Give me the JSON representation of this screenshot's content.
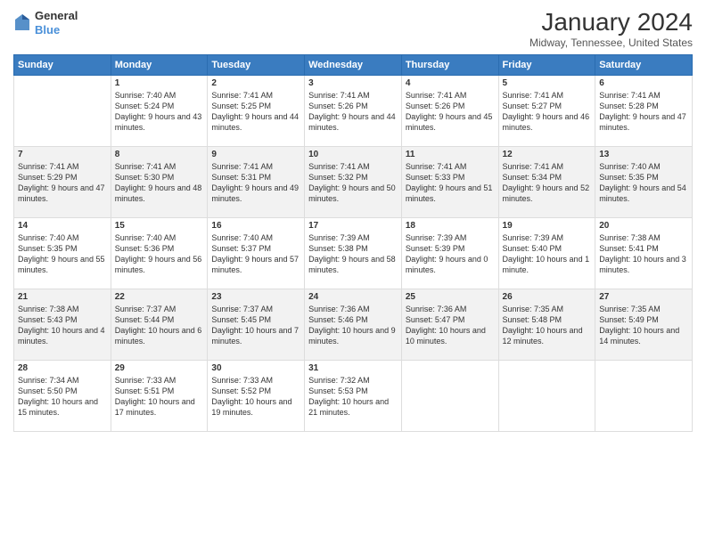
{
  "header": {
    "logo_general": "General",
    "logo_blue": "Blue",
    "title": "January 2024",
    "location": "Midway, Tennessee, United States"
  },
  "weekdays": [
    "Sunday",
    "Monday",
    "Tuesday",
    "Wednesday",
    "Thursday",
    "Friday",
    "Saturday"
  ],
  "weeks": [
    [
      {
        "day": "",
        "sunrise": "",
        "sunset": "",
        "daylight": ""
      },
      {
        "day": "1",
        "sunrise": "Sunrise: 7:40 AM",
        "sunset": "Sunset: 5:24 PM",
        "daylight": "Daylight: 9 hours and 43 minutes."
      },
      {
        "day": "2",
        "sunrise": "Sunrise: 7:41 AM",
        "sunset": "Sunset: 5:25 PM",
        "daylight": "Daylight: 9 hours and 44 minutes."
      },
      {
        "day": "3",
        "sunrise": "Sunrise: 7:41 AM",
        "sunset": "Sunset: 5:26 PM",
        "daylight": "Daylight: 9 hours and 44 minutes."
      },
      {
        "day": "4",
        "sunrise": "Sunrise: 7:41 AM",
        "sunset": "Sunset: 5:26 PM",
        "daylight": "Daylight: 9 hours and 45 minutes."
      },
      {
        "day": "5",
        "sunrise": "Sunrise: 7:41 AM",
        "sunset": "Sunset: 5:27 PM",
        "daylight": "Daylight: 9 hours and 46 minutes."
      },
      {
        "day": "6",
        "sunrise": "Sunrise: 7:41 AM",
        "sunset": "Sunset: 5:28 PM",
        "daylight": "Daylight: 9 hours and 47 minutes."
      }
    ],
    [
      {
        "day": "7",
        "sunrise": "Sunrise: 7:41 AM",
        "sunset": "Sunset: 5:29 PM",
        "daylight": "Daylight: 9 hours and 47 minutes."
      },
      {
        "day": "8",
        "sunrise": "Sunrise: 7:41 AM",
        "sunset": "Sunset: 5:30 PM",
        "daylight": "Daylight: 9 hours and 48 minutes."
      },
      {
        "day": "9",
        "sunrise": "Sunrise: 7:41 AM",
        "sunset": "Sunset: 5:31 PM",
        "daylight": "Daylight: 9 hours and 49 minutes."
      },
      {
        "day": "10",
        "sunrise": "Sunrise: 7:41 AM",
        "sunset": "Sunset: 5:32 PM",
        "daylight": "Daylight: 9 hours and 50 minutes."
      },
      {
        "day": "11",
        "sunrise": "Sunrise: 7:41 AM",
        "sunset": "Sunset: 5:33 PM",
        "daylight": "Daylight: 9 hours and 51 minutes."
      },
      {
        "day": "12",
        "sunrise": "Sunrise: 7:41 AM",
        "sunset": "Sunset: 5:34 PM",
        "daylight": "Daylight: 9 hours and 52 minutes."
      },
      {
        "day": "13",
        "sunrise": "Sunrise: 7:40 AM",
        "sunset": "Sunset: 5:35 PM",
        "daylight": "Daylight: 9 hours and 54 minutes."
      }
    ],
    [
      {
        "day": "14",
        "sunrise": "Sunrise: 7:40 AM",
        "sunset": "Sunset: 5:35 PM",
        "daylight": "Daylight: 9 hours and 55 minutes."
      },
      {
        "day": "15",
        "sunrise": "Sunrise: 7:40 AM",
        "sunset": "Sunset: 5:36 PM",
        "daylight": "Daylight: 9 hours and 56 minutes."
      },
      {
        "day": "16",
        "sunrise": "Sunrise: 7:40 AM",
        "sunset": "Sunset: 5:37 PM",
        "daylight": "Daylight: 9 hours and 57 minutes."
      },
      {
        "day": "17",
        "sunrise": "Sunrise: 7:39 AM",
        "sunset": "Sunset: 5:38 PM",
        "daylight": "Daylight: 9 hours and 58 minutes."
      },
      {
        "day": "18",
        "sunrise": "Sunrise: 7:39 AM",
        "sunset": "Sunset: 5:39 PM",
        "daylight": "Daylight: 9 hours and 0 minutes."
      },
      {
        "day": "19",
        "sunrise": "Sunrise: 7:39 AM",
        "sunset": "Sunset: 5:40 PM",
        "daylight": "Daylight: 10 hours and 1 minute."
      },
      {
        "day": "20",
        "sunrise": "Sunrise: 7:38 AM",
        "sunset": "Sunset: 5:41 PM",
        "daylight": "Daylight: 10 hours and 3 minutes."
      }
    ],
    [
      {
        "day": "21",
        "sunrise": "Sunrise: 7:38 AM",
        "sunset": "Sunset: 5:43 PM",
        "daylight": "Daylight: 10 hours and 4 minutes."
      },
      {
        "day": "22",
        "sunrise": "Sunrise: 7:37 AM",
        "sunset": "Sunset: 5:44 PM",
        "daylight": "Daylight: 10 hours and 6 minutes."
      },
      {
        "day": "23",
        "sunrise": "Sunrise: 7:37 AM",
        "sunset": "Sunset: 5:45 PM",
        "daylight": "Daylight: 10 hours and 7 minutes."
      },
      {
        "day": "24",
        "sunrise": "Sunrise: 7:36 AM",
        "sunset": "Sunset: 5:46 PM",
        "daylight": "Daylight: 10 hours and 9 minutes."
      },
      {
        "day": "25",
        "sunrise": "Sunrise: 7:36 AM",
        "sunset": "Sunset: 5:47 PM",
        "daylight": "Daylight: 10 hours and 10 minutes."
      },
      {
        "day": "26",
        "sunrise": "Sunrise: 7:35 AM",
        "sunset": "Sunset: 5:48 PM",
        "daylight": "Daylight: 10 hours and 12 minutes."
      },
      {
        "day": "27",
        "sunrise": "Sunrise: 7:35 AM",
        "sunset": "Sunset: 5:49 PM",
        "daylight": "Daylight: 10 hours and 14 minutes."
      }
    ],
    [
      {
        "day": "28",
        "sunrise": "Sunrise: 7:34 AM",
        "sunset": "Sunset: 5:50 PM",
        "daylight": "Daylight: 10 hours and 15 minutes."
      },
      {
        "day": "29",
        "sunrise": "Sunrise: 7:33 AM",
        "sunset": "Sunset: 5:51 PM",
        "daylight": "Daylight: 10 hours and 17 minutes."
      },
      {
        "day": "30",
        "sunrise": "Sunrise: 7:33 AM",
        "sunset": "Sunset: 5:52 PM",
        "daylight": "Daylight: 10 hours and 19 minutes."
      },
      {
        "day": "31",
        "sunrise": "Sunrise: 7:32 AM",
        "sunset": "Sunset: 5:53 PM",
        "daylight": "Daylight: 10 hours and 21 minutes."
      },
      {
        "day": "",
        "sunrise": "",
        "sunset": "",
        "daylight": ""
      },
      {
        "day": "",
        "sunrise": "",
        "sunset": "",
        "daylight": ""
      },
      {
        "day": "",
        "sunrise": "",
        "sunset": "",
        "daylight": ""
      }
    ]
  ]
}
